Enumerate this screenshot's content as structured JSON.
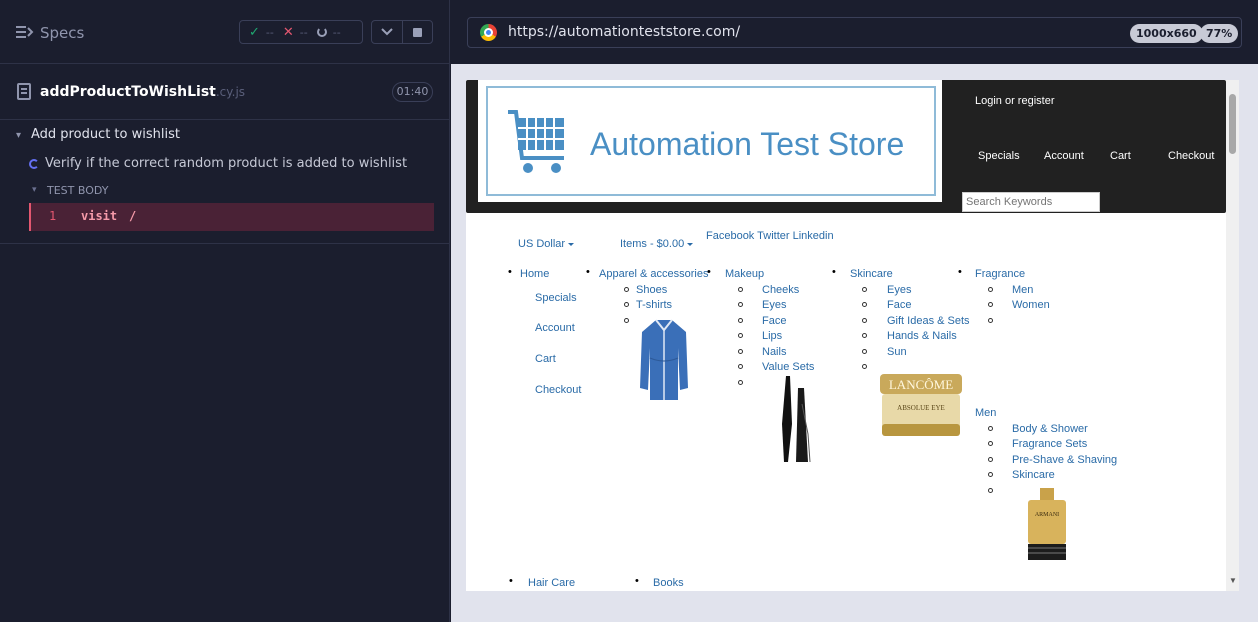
{
  "runner": {
    "specs_label": "Specs",
    "stats": {
      "passed": "--",
      "failed": "--",
      "pending": "--"
    },
    "spec_file": {
      "name": "addProductToWishList",
      "ext": ".cy.js",
      "duration": "01:40"
    },
    "suite_title": "Add product to wishlist",
    "test_title": "Verify if the correct random product is added to wishlist",
    "test_body_label": "TEST BODY",
    "command": {
      "number": "1",
      "name": "visit",
      "message": "/"
    }
  },
  "browser": {
    "url": "https://automationteststore.com/",
    "viewport": "1000x660",
    "zoom": "77%"
  },
  "store": {
    "logo_text": "Automation Test Store",
    "login": "Login or register",
    "topnav": [
      "Specials",
      "Account",
      "Cart",
      "Checkout"
    ],
    "search_placeholder": "Search Keywords",
    "currency": "US Dollar",
    "items": "Items - $0.00",
    "social": "Facebook Twitter Linkedin",
    "home_menu": {
      "label": "Home",
      "items": [
        "Specials",
        "Account",
        "Cart",
        "Checkout"
      ]
    },
    "apparel": {
      "label": "Apparel & accessories",
      "items": [
        "Shoes",
        "T-shirts"
      ]
    },
    "makeup": {
      "label": "Makeup",
      "items": [
        "Cheeks",
        "Eyes",
        "Face",
        "Lips",
        "Nails",
        "Value Sets"
      ]
    },
    "skincare": {
      "label": "Skincare",
      "items": [
        "Eyes",
        "Face",
        "Gift Ideas & Sets",
        "Hands & Nails",
        "Sun"
      ]
    },
    "fragrance": {
      "label": "Fragrance",
      "items": [
        "Men",
        "Women"
      ],
      "men_label": "Men",
      "men_items": [
        "Body & Shower",
        "Fragrance Sets",
        "Pre-Shave & Shaving",
        "Skincare"
      ]
    },
    "haircare": "Hair Care",
    "books": "Books",
    "product_labels": {
      "cream_brand": "LANCÔME",
      "cream_name": "ABSOLUE EYE",
      "perfume_brand": "ARMANI"
    }
  },
  "colors": {
    "accent": "#6470f3",
    "fail": "#e45770",
    "pass": "#1fa971",
    "store_link": "#2a6ba7",
    "logo_blue": "#4a8fc4"
  }
}
